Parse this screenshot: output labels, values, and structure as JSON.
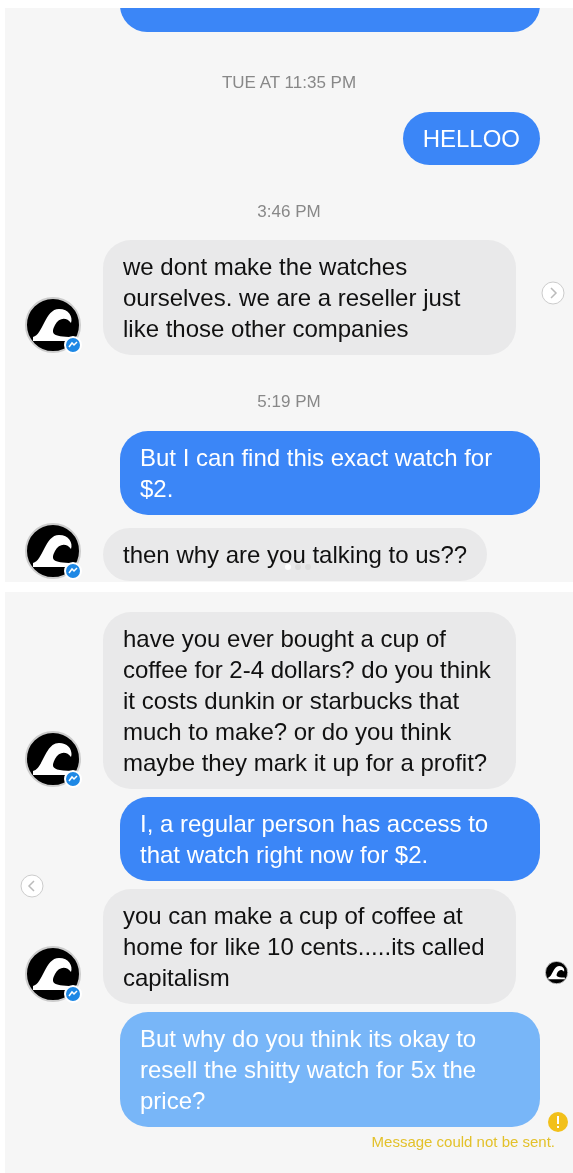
{
  "panels": [
    {
      "next_arrow": true,
      "previous_arrow": false,
      "messages": [
        {
          "kind": "cut_sent"
        },
        {
          "kind": "timestamp",
          "text": "TUE AT 11:35 PM"
        },
        {
          "kind": "sent",
          "text": "HELLOO",
          "failed": false
        },
        {
          "kind": "timestamp",
          "text": "3:46 PM"
        },
        {
          "kind": "received",
          "text": "we dont make the watches ourselves. we are a reseller just like those other companies",
          "seen": false
        },
        {
          "kind": "timestamp",
          "text": "5:19 PM"
        },
        {
          "kind": "sent",
          "text": "But I can find this exact watch for $2.",
          "failed": false
        },
        {
          "kind": "received",
          "text": "then why are you talking to us??",
          "seen": false
        }
      ]
    },
    {
      "next_arrow": false,
      "previous_arrow": true,
      "messages": [
        {
          "kind": "received",
          "text": "have you ever bought a cup of coffee for 2-4 dollars?  do you think it costs dunkin or starbucks that much to make? or do you think maybe they mark it up for a profit?",
          "seen": false
        },
        {
          "kind": "sent",
          "text": "I, a regular person has access to that watch right now for $2.",
          "failed": false
        },
        {
          "kind": "received",
          "text": "you can make a cup of coffee at home for like 10 cents.....its called capitalism",
          "seen": true
        },
        {
          "kind": "sent",
          "text": "But why do you think its okay to resell the shitty watch for 5x the price?",
          "failed": true,
          "error": "Message could not be sent."
        }
      ]
    }
  ]
}
